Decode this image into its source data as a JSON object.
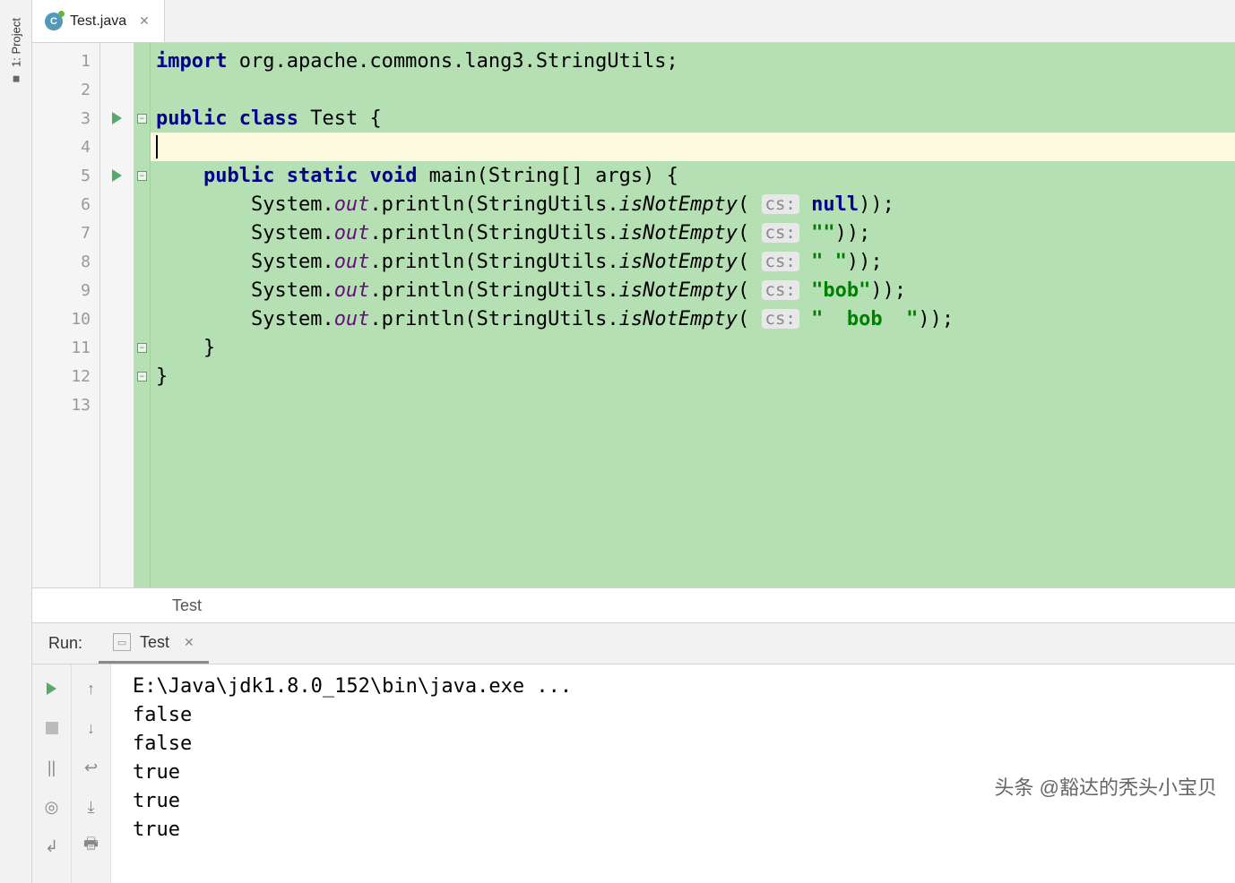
{
  "sidebar": {
    "project_label": "1: Project"
  },
  "tab": {
    "filename": "Test.java",
    "file_icon_letter": "C"
  },
  "gutter": {
    "lines": [
      "1",
      "2",
      "3",
      "4",
      "5",
      "6",
      "7",
      "8",
      "9",
      "10",
      "11",
      "12",
      "13"
    ]
  },
  "current_line_index": 3,
  "code": {
    "import_kw": "import",
    "import_pkg": " org.apache.commons.lang3.StringUtils;",
    "public": "public",
    "class_kw": "class",
    "class_name": " Test {",
    "static": "static",
    "void": "void",
    "main_sig": " main(String[] args) {",
    "sysout_pre": "System.",
    "out": "out",
    "println_pre": ".println(StringUtils.",
    "isNotEmpty": "isNotEmpty",
    "open_par": "( ",
    "hint": "cs:",
    "null_kw": "null",
    "close_par1": "));",
    "str_empty": "\"\"",
    "str_space": "\" \"",
    "str_bob": "\"bob\"",
    "str_bob_sp": "\"  bob  \"",
    "brace_close1": "}",
    "brace_close2": "}"
  },
  "breadcrumb": {
    "text": "Test"
  },
  "run": {
    "label": "Run:",
    "tab_name": "Test"
  },
  "console": {
    "lines": [
      "E:\\Java\\jdk1.8.0_152\\bin\\java.exe ...",
      "false",
      "false",
      "true",
      "true",
      "true"
    ]
  },
  "watermark": "头条 @豁达的秃头小宝贝"
}
